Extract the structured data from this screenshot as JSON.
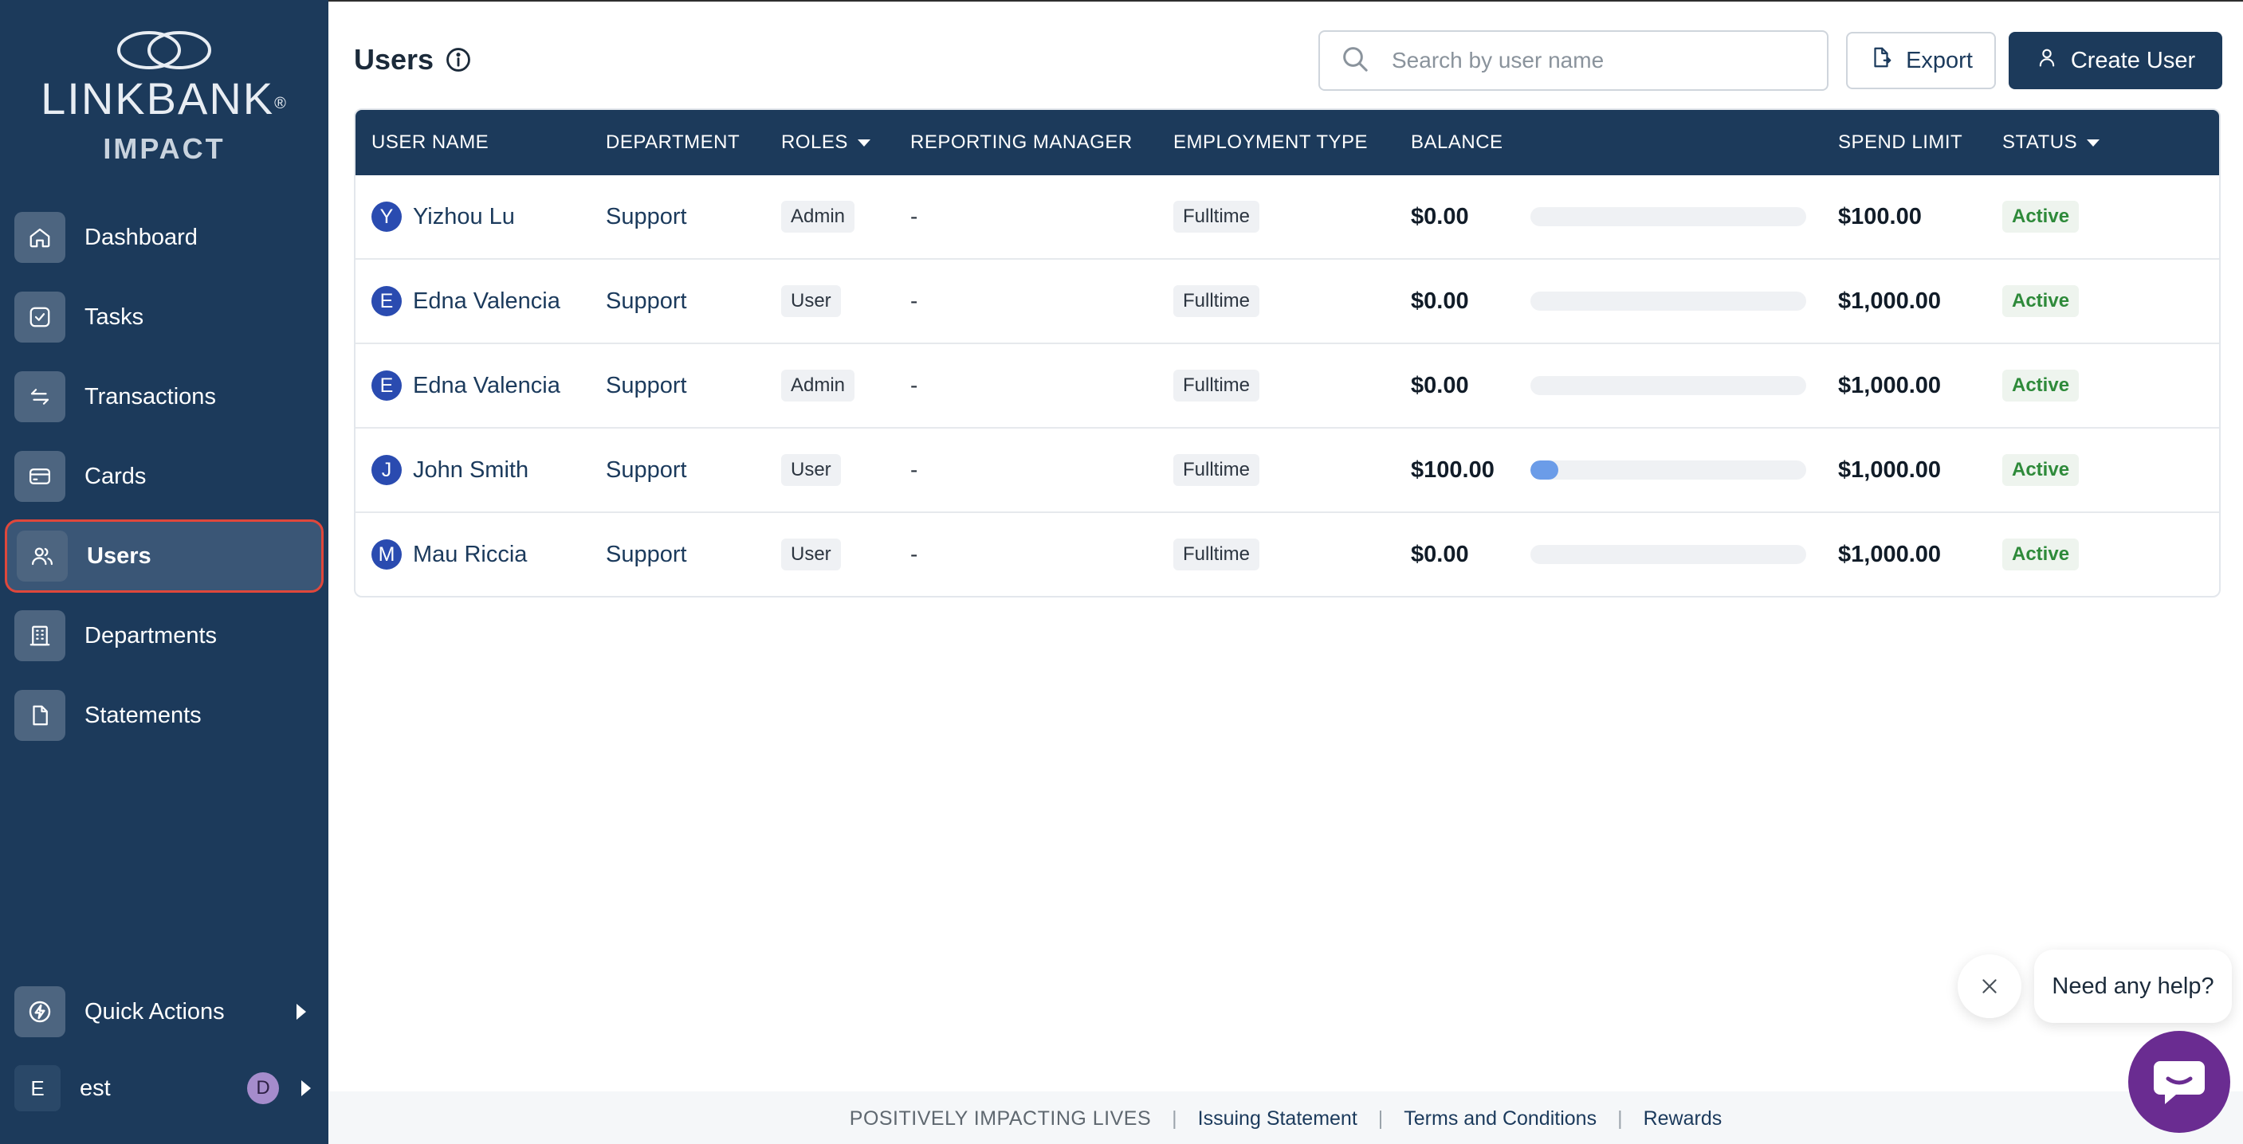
{
  "brand": {
    "name": "LINKBANK",
    "registered": "®",
    "sub": "IMPACT"
  },
  "sidebar": {
    "items": [
      {
        "label": "Dashboard",
        "icon": "home-icon"
      },
      {
        "label": "Tasks",
        "icon": "check-square-icon"
      },
      {
        "label": "Transactions",
        "icon": "transfer-arrows-icon"
      },
      {
        "label": "Cards",
        "icon": "credit-card-icon"
      },
      {
        "label": "Users",
        "icon": "users-icon",
        "active": true
      },
      {
        "label": "Departments",
        "icon": "building-icon"
      },
      {
        "label": "Statements",
        "icon": "document-icon"
      }
    ],
    "quick_actions": {
      "label": "Quick Actions",
      "icon": "lightning-icon"
    },
    "account": {
      "initial": "E",
      "name": "est",
      "badge": "D"
    }
  },
  "page": {
    "title": "Users"
  },
  "search": {
    "placeholder": "Search by user name",
    "value": ""
  },
  "toolbar": {
    "export_label": "Export",
    "create_label": "Create User"
  },
  "table": {
    "columns": [
      {
        "label": "USER NAME"
      },
      {
        "label": "DEPARTMENT"
      },
      {
        "label": "ROLES",
        "sortable": true
      },
      {
        "label": "REPORTING MANAGER"
      },
      {
        "label": "EMPLOYMENT TYPE"
      },
      {
        "label": "BALANCE"
      },
      {
        "label": "SPEND LIMIT"
      },
      {
        "label": "STATUS",
        "sortable": true
      }
    ],
    "rows": [
      {
        "initial": "Y",
        "name": "Yizhou Lu",
        "department": "Support",
        "role": "Admin",
        "manager": "-",
        "employment": "Fulltime",
        "balance": "$0.00",
        "balance_fraction": 0.0,
        "spend_limit": "$100.00",
        "status": "Active"
      },
      {
        "initial": "E",
        "name": "Edna Valencia",
        "department": "Support",
        "role": "User",
        "manager": "-",
        "employment": "Fulltime",
        "balance": "$0.00",
        "balance_fraction": 0.0,
        "spend_limit": "$1,000.00",
        "status": "Active"
      },
      {
        "initial": "E",
        "name": "Edna Valencia",
        "department": "Support",
        "role": "Admin",
        "manager": "-",
        "employment": "Fulltime",
        "balance": "$0.00",
        "balance_fraction": 0.0,
        "spend_limit": "$1,000.00",
        "status": "Active"
      },
      {
        "initial": "J",
        "name": "John Smith",
        "department": "Support",
        "role": "User",
        "manager": "-",
        "employment": "Fulltime",
        "balance": "$100.00",
        "balance_fraction": 0.1,
        "spend_limit": "$1,000.00",
        "status": "Active"
      },
      {
        "initial": "M",
        "name": "Mau Riccia",
        "department": "Support",
        "role": "User",
        "manager": "-",
        "employment": "Fulltime",
        "balance": "$0.00",
        "balance_fraction": 0.0,
        "spend_limit": "$1,000.00",
        "status": "Active"
      }
    ]
  },
  "footer": {
    "tagline": "POSITIVELY IMPACTING LIVES",
    "separator": "|",
    "links": [
      "Issuing Statement",
      "Terms and Conditions",
      "Rewards"
    ]
  },
  "help": {
    "bubble_text": "Need any help?"
  },
  "colors": {
    "sidebar_bg": "#1c3a5b",
    "active_outline": "#e0473b",
    "status_green": "#2e8a3a",
    "balance_bar": "#6b9ce8",
    "help_purple": "#6a2c91"
  }
}
